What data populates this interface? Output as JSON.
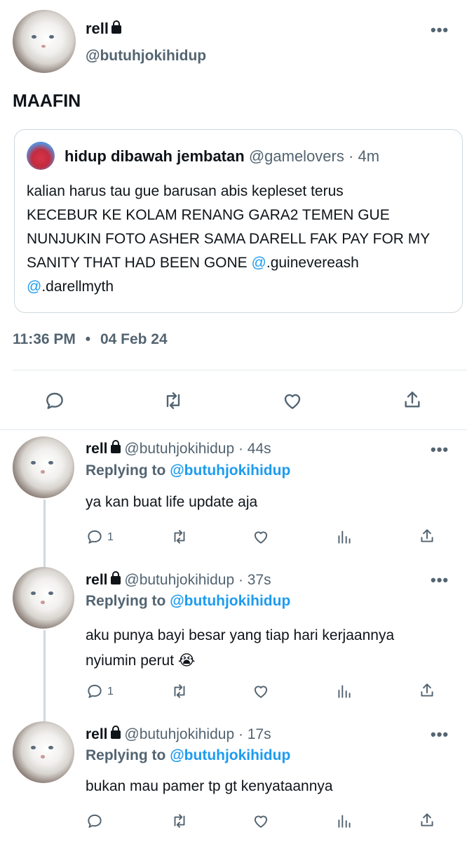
{
  "main_tweet": {
    "name": "rell",
    "handle": "@butuhjokihidup",
    "text": "MAAFIN",
    "time": "11:36 PM",
    "separator": "•",
    "date": "04 Feb 24"
  },
  "quoted_tweet": {
    "name": "hidup dibawah jembatan",
    "handle": "@gamelovers",
    "dot": "·",
    "age": "4m",
    "line1": "kalian harus tau gue barusan abis kepleset terus",
    "line2": "KECEBUR KE KOLAM RENANG GARA2 TEMEN GUE",
    "line3": "NUNJUKIN FOTO ASHER SAMA DARELL FAK PAY FOR MY",
    "line4_text": "SANITY THAT HAD BEEN GONE",
    "mention1_at": "@",
    "mention1_rest": ".guinevereash",
    "mention2_at": "@",
    "mention2_rest": ".darellmyth"
  },
  "replies": [
    {
      "name": "rell",
      "handle": "@butuhjokihidup",
      "age": "· 44s",
      "replying_label": "Replying to",
      "replying_handle": "@butuhjokihidup",
      "text": "ya kan buat life update aja",
      "reply_count": "1"
    },
    {
      "name": "rell",
      "handle": "@butuhjokihidup",
      "age": "· 37s",
      "replying_label": "Replying to",
      "replying_handle": "@butuhjokihidup",
      "text_line1": "aku punya bayi besar yang tiap hari kerjaannya",
      "text_line2": "nyiumin perut 😭",
      "reply_count": "1"
    },
    {
      "name": "rell",
      "handle": "@butuhjokihidup",
      "age": "· 17s",
      "replying_label": "Replying to",
      "replying_handle": "@butuhjokihidup",
      "text": "bukan mau pamer tp gt kenyataannya",
      "reply_count": ""
    }
  ],
  "icons": {
    "reply": "reply-icon",
    "retweet": "retweet-icon",
    "like": "like-icon",
    "views": "views-icon",
    "share": "share-icon",
    "more": "more-icon",
    "lock": "lock-icon"
  },
  "colors": {
    "accent": "#1d9bf0",
    "muted": "#536471",
    "text": "#0f1419",
    "border": "#cfd9de"
  }
}
